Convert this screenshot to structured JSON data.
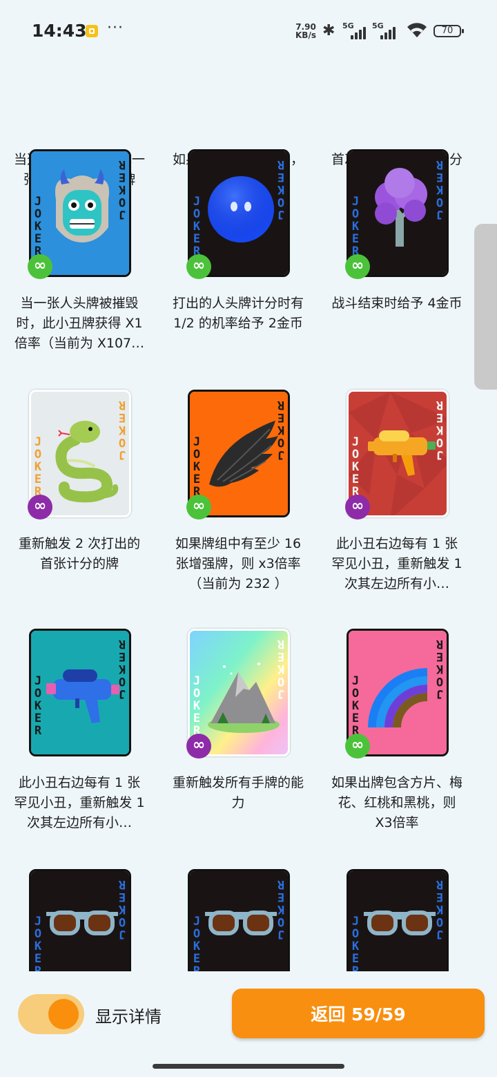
{
  "status_bar": {
    "time": "14:43",
    "more": "···",
    "net_speed_value": "7.90",
    "net_speed_unit": "KB/s",
    "sim1": "5G",
    "sim2": "5G",
    "battery": "70"
  },
  "jokers": [
    {
      "desc": "当选择战斗时，生成一张负片'眼镜'小丑牌",
      "art": "partial",
      "badge": ""
    },
    {
      "desc": "如果出牌中包含顺子，则 +100筹码",
      "art": "partial",
      "badge": ""
    },
    {
      "desc": "首次打出的人头牌计分时给予 X2倍率",
      "art": "partial",
      "badge": ""
    },
    {
      "desc": "当一张人头牌被摧毁时，此小丑牌获得 X1倍率（当前为 X107…",
      "art": "demon-mask-icon",
      "badge": "green",
      "bg": "#2c90dc",
      "joker_color": "#1a1a1a"
    },
    {
      "desc": "打出的人头牌计分时有 1/2 的机率给予 2金币",
      "art": "blue-slime-icon",
      "badge": "green",
      "bg": "#191413",
      "joker_color": "#2a6fe0"
    },
    {
      "desc": "战斗结束时给予 4金币",
      "art": "purple-tree-icon",
      "badge": "green",
      "bg": "#191413",
      "joker_color": "#2a6fe0"
    },
    {
      "desc": "重新触发 2 次打出的首张计分的牌",
      "art": "snake-icon",
      "badge": "purple",
      "bg": "#e6ebee",
      "joker_color": "#f0a030",
      "light": true
    },
    {
      "desc": "如果牌组中有至少 16 张增强牌，则 x3倍率（当前为 232 ）",
      "art": "black-wing-icon",
      "badge": "green",
      "bg": "#fc6a0a",
      "joker_color": "#1a1a1a"
    },
    {
      "desc": "此小丑右边每有 1 张罕见小丑，重新触发 1 次其左边所有小…",
      "art": "orange-water-gun-icon",
      "badge": "purple",
      "bg": "#c63e36",
      "joker_color": "#f4f4f4",
      "light": true
    },
    {
      "desc": "此小丑右边每有 1 张罕见小丑，重新触发 1 次其左边所有小…",
      "art": "blue-water-gun-icon",
      "badge": "",
      "bg": "#18a9b0",
      "joker_color": "#1a1a1a"
    },
    {
      "desc": "重新触发所有手牌的能力",
      "art": "mountain-icon",
      "badge": "purple",
      "bg": "rainbow",
      "joker_color": "#ffffff",
      "light": true
    },
    {
      "desc": "如果出牌包含方片、梅花、红桃和黑桃，则 X3倍率",
      "art": "rainbow-icon",
      "badge": "green",
      "bg": "#f56a9a",
      "joker_color": "#1a1a1a"
    },
    {
      "desc": "",
      "art": "sunglasses-icon",
      "badge": "",
      "bg": "#191413",
      "joker_color": "#2a6fe0"
    },
    {
      "desc": "",
      "art": "sunglasses-icon",
      "badge": "",
      "bg": "#191413",
      "joker_color": "#2a6fe0"
    },
    {
      "desc": "",
      "art": "sunglasses-icon",
      "badge": "",
      "bg": "#191413",
      "joker_color": "#2a6fe0"
    }
  ],
  "joker_word": "JOKER",
  "badge_symbol": "∞",
  "bottom": {
    "toggle_label": "显示详情",
    "toggle_on": true,
    "return_label": "返回 59/59"
  },
  "colors": {
    "background": "#eef6fa",
    "accent_orange": "#f88f10",
    "badge_green": "#4cc23a",
    "badge_purple": "#8e2ba8"
  }
}
